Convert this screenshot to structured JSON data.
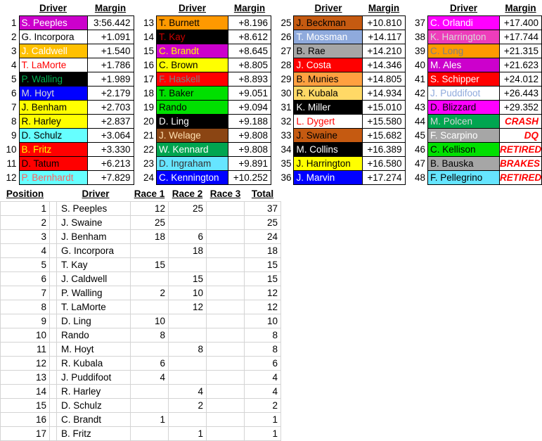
{
  "results": {
    "headers": {
      "driver": "Driver",
      "margin": "Margin"
    },
    "blocks": [
      {
        "rows": [
          {
            "pos": "1",
            "driver": "S. Peeples",
            "margin": "3:56.442",
            "bg": "#cc00cc",
            "fg": "#ffffff",
            "status": false
          },
          {
            "pos": "2",
            "driver": "G. Incorpora",
            "margin": "+1.091",
            "bg": "#ffffff",
            "fg": "#000000",
            "status": false
          },
          {
            "pos": "3",
            "driver": "J. Caldwell",
            "margin": "+1.540",
            "bg": "#ffc000",
            "fg": "#ffffff",
            "status": false
          },
          {
            "pos": "4",
            "driver": "T. LaMorte",
            "margin": "+1.786",
            "bg": "#ffffff",
            "fg": "#ff0000",
            "status": false
          },
          {
            "pos": "5",
            "driver": "P. Walling",
            "margin": "+1.989",
            "bg": "#000000",
            "fg": "#00b050",
            "status": false
          },
          {
            "pos": "6",
            "driver": "M. Hoyt",
            "margin": "+2.179",
            "bg": "#0000ff",
            "fg": "#d9d9d9",
            "status": false
          },
          {
            "pos": "7",
            "driver": "J. Benham",
            "margin": "+2.703",
            "bg": "#ffff00",
            "fg": "#000000",
            "status": false
          },
          {
            "pos": "8",
            "driver": "R. Harley",
            "margin": "+2.837",
            "bg": "#ffff00",
            "fg": "#000000",
            "status": false
          },
          {
            "pos": "9",
            "driver": "D. Schulz",
            "margin": "+3.064",
            "bg": "#66ffff",
            "fg": "#000000",
            "status": false
          },
          {
            "pos": "10",
            "driver": "B. Fritz",
            "margin": "+3.330",
            "bg": "#ff0000",
            "fg": "#ffff00",
            "status": false
          },
          {
            "pos": "11",
            "driver": "D. Tatum",
            "margin": "+6.213",
            "bg": "#ff0000",
            "fg": "#000000",
            "status": false
          },
          {
            "pos": "12",
            "driver": "P. Bernhardt",
            "margin": "+7.829",
            "bg": "#66ffff",
            "fg": "#ff6060",
            "status": false
          }
        ]
      },
      {
        "rows": [
          {
            "pos": "13",
            "driver": "T. Burnett",
            "margin": "+8.196",
            "bg": "#ff9900",
            "fg": "#000000",
            "status": false
          },
          {
            "pos": "14",
            "driver": "T. Kay",
            "margin": "+8.612",
            "bg": "#000000",
            "fg": "#cc0000",
            "status": false
          },
          {
            "pos": "15",
            "driver": "C. Brandt",
            "margin": "+8.645",
            "bg": "#cc00cc",
            "fg": "#ffff00",
            "status": false
          },
          {
            "pos": "16",
            "driver": "C. Brown",
            "margin": "+8.805",
            "bg": "#ffff00",
            "fg": "#000000",
            "status": false
          },
          {
            "pos": "17",
            "driver": "F. Haskell",
            "margin": "+8.893",
            "bg": "#ff0000",
            "fg": "#808080",
            "status": false
          },
          {
            "pos": "18",
            "driver": "T. Baker",
            "margin": "+9.051",
            "bg": "#00e000",
            "fg": "#000000",
            "status": false
          },
          {
            "pos": "19",
            "driver": "Rando",
            "margin": "+9.094",
            "bg": "#00e000",
            "fg": "#000000",
            "status": false
          },
          {
            "pos": "20",
            "driver": "D. Ling",
            "margin": "+9.188",
            "bg": "#000000",
            "fg": "#ffffff",
            "status": false
          },
          {
            "pos": "21",
            "driver": "J. Welage",
            "margin": "+9.808",
            "bg": "#8b4513",
            "fg": "#ffe0b0",
            "status": false
          },
          {
            "pos": "22",
            "driver": "W. Kennard",
            "margin": "+9.808",
            "bg": "#00a550",
            "fg": "#ffffff",
            "status": false
          },
          {
            "pos": "23",
            "driver": "D. Ingraham",
            "margin": "+9.891",
            "bg": "#66e5ff",
            "fg": "#333333",
            "status": false
          },
          {
            "pos": "24",
            "driver": "C. Kennington",
            "margin": "+10.252",
            "bg": "#0000ff",
            "fg": "#ffffff",
            "status": false
          }
        ]
      },
      {
        "rows": [
          {
            "pos": "25",
            "driver": "J. Beckman",
            "margin": "+10.810",
            "bg": "#c55a11",
            "fg": "#000000",
            "status": false
          },
          {
            "pos": "26",
            "driver": "T. Mossman",
            "margin": "+14.117",
            "bg": "#8faadc",
            "fg": "#ffffff",
            "status": false
          },
          {
            "pos": "27",
            "driver": "B. Rae",
            "margin": "+14.210",
            "bg": "#a6a6a6",
            "fg": "#000000",
            "status": false
          },
          {
            "pos": "28",
            "driver": "J. Costa",
            "margin": "+14.346",
            "bg": "#ff0000",
            "fg": "#ffffff",
            "status": false
          },
          {
            "pos": "29",
            "driver": "B. Munies",
            "margin": "+14.805",
            "bg": "#ffa040",
            "fg": "#000000",
            "status": false
          },
          {
            "pos": "30",
            "driver": "R. Kubala",
            "margin": "+14.934",
            "bg": "#ffd966",
            "fg": "#000000",
            "status": false
          },
          {
            "pos": "31",
            "driver": "K. Miller",
            "margin": "+15.010",
            "bg": "#000000",
            "fg": "#ffffff",
            "status": false
          },
          {
            "pos": "32",
            "driver": "L. Dygert",
            "margin": "+15.580",
            "bg": "#ffffff",
            "fg": "#ff0000",
            "status": false
          },
          {
            "pos": "33",
            "driver": "J. Swaine",
            "margin": "+15.682",
            "bg": "#c55a11",
            "fg": "#000000",
            "status": false
          },
          {
            "pos": "34",
            "driver": "M. Collins",
            "margin": "+16.389",
            "bg": "#000000",
            "fg": "#ffffff",
            "status": false
          },
          {
            "pos": "35",
            "driver": "J. Harrington",
            "margin": "+16.580",
            "bg": "#ffff00",
            "fg": "#000000",
            "status": false
          },
          {
            "pos": "36",
            "driver": "J. Marvin",
            "margin": "+17.274",
            "bg": "#0000ff",
            "fg": "#ffffff",
            "status": false
          }
        ]
      },
      {
        "rows": [
          {
            "pos": "37",
            "driver": "C. Orlandi",
            "margin": "+17.400",
            "bg": "#ff00ff",
            "fg": "#ffffff",
            "status": false
          },
          {
            "pos": "38",
            "driver": "K. Harrington",
            "margin": "+17.744",
            "bg": "#ee3dbb",
            "fg": "#d9d9d9",
            "status": false
          },
          {
            "pos": "39",
            "driver": "C. Long",
            "margin": "+21.315",
            "bg": "#ff9900",
            "fg": "#808080",
            "status": false
          },
          {
            "pos": "40",
            "driver": "M. Ales",
            "margin": "+21.623",
            "bg": "#cc00cc",
            "fg": "#ffffff",
            "status": false
          },
          {
            "pos": "41",
            "driver": "S. Schipper",
            "margin": "+24.012",
            "bg": "#ff0000",
            "fg": "#ffffff",
            "status": false
          },
          {
            "pos": "42",
            "driver": "J. Puddifoot",
            "margin": "+26.443",
            "bg": "#ffffff",
            "fg": "#8faadc",
            "status": false
          },
          {
            "pos": "43",
            "driver": "D. Blizzard",
            "margin": "+29.352",
            "bg": "#ff00ff",
            "fg": "#000000",
            "status": false
          },
          {
            "pos": "44",
            "driver": "M. Polcen",
            "margin": "CRASH",
            "bg": "#00a550",
            "fg": "#d9d9d9",
            "status": true
          },
          {
            "pos": "45",
            "driver": "F. Scarpino",
            "margin": "DQ",
            "bg": "#a6a6a6",
            "fg": "#ffffff",
            "status": true
          },
          {
            "pos": "46",
            "driver": "C. Kellison",
            "margin": "RETIRED",
            "bg": "#00e000",
            "fg": "#000000",
            "status": true
          },
          {
            "pos": "47",
            "driver": "B. Bauska",
            "margin": "BRAKES",
            "bg": "#a6a6a6",
            "fg": "#000000",
            "status": true
          },
          {
            "pos": "48",
            "driver": "F. Pellegrino",
            "margin": "RETIRED",
            "bg": "#66e5ff",
            "fg": "#000000",
            "status": true
          }
        ]
      }
    ]
  },
  "standings": {
    "headers": [
      "Position",
      "",
      "Driver",
      "Race 1",
      "Race 2",
      "Race 3",
      "Total"
    ],
    "rows": [
      {
        "position": "1",
        "driver": "S. Peeples",
        "race1": "12",
        "race2": "25",
        "race3": "",
        "total": "37"
      },
      {
        "position": "2",
        "driver": "J. Swaine",
        "race1": "25",
        "race2": "",
        "race3": "",
        "total": "25"
      },
      {
        "position": "3",
        "driver": "J. Benham",
        "race1": "18",
        "race2": "6",
        "race3": "",
        "total": "24"
      },
      {
        "position": "4",
        "driver": "G. Incorpora",
        "race1": "",
        "race2": "18",
        "race3": "",
        "total": "18"
      },
      {
        "position": "5",
        "driver": "T. Kay",
        "race1": "15",
        "race2": "",
        "race3": "",
        "total": "15"
      },
      {
        "position": "6",
        "driver": "J. Caldwell",
        "race1": "",
        "race2": "15",
        "race3": "",
        "total": "15"
      },
      {
        "position": "7",
        "driver": "P. Walling",
        "race1": "2",
        "race2": "10",
        "race3": "",
        "total": "12"
      },
      {
        "position": "8",
        "driver": "T. LaMorte",
        "race1": "",
        "race2": "12",
        "race3": "",
        "total": "12"
      },
      {
        "position": "9",
        "driver": "D. Ling",
        "race1": "10",
        "race2": "",
        "race3": "",
        "total": "10"
      },
      {
        "position": "10",
        "driver": "Rando",
        "race1": "8",
        "race2": "",
        "race3": "",
        "total": "8"
      },
      {
        "position": "11",
        "driver": "M. Hoyt",
        "race1": "",
        "race2": "8",
        "race3": "",
        "total": "8"
      },
      {
        "position": "12",
        "driver": "R. Kubala",
        "race1": "6",
        "race2": "",
        "race3": "",
        "total": "6"
      },
      {
        "position": "13",
        "driver": "J. Puddifoot",
        "race1": "4",
        "race2": "",
        "race3": "",
        "total": "4"
      },
      {
        "position": "14",
        "driver": "R. Harley",
        "race1": "",
        "race2": "4",
        "race3": "",
        "total": "4"
      },
      {
        "position": "15",
        "driver": "D. Schulz",
        "race1": "",
        "race2": "2",
        "race3": "",
        "total": "2"
      },
      {
        "position": "16",
        "driver": "C. Brandt",
        "race1": "1",
        "race2": "",
        "race3": "",
        "total": "1"
      },
      {
        "position": "17",
        "driver": "B. Fritz",
        "race1": "",
        "race2": "1",
        "race3": "",
        "total": "1"
      }
    ]
  }
}
